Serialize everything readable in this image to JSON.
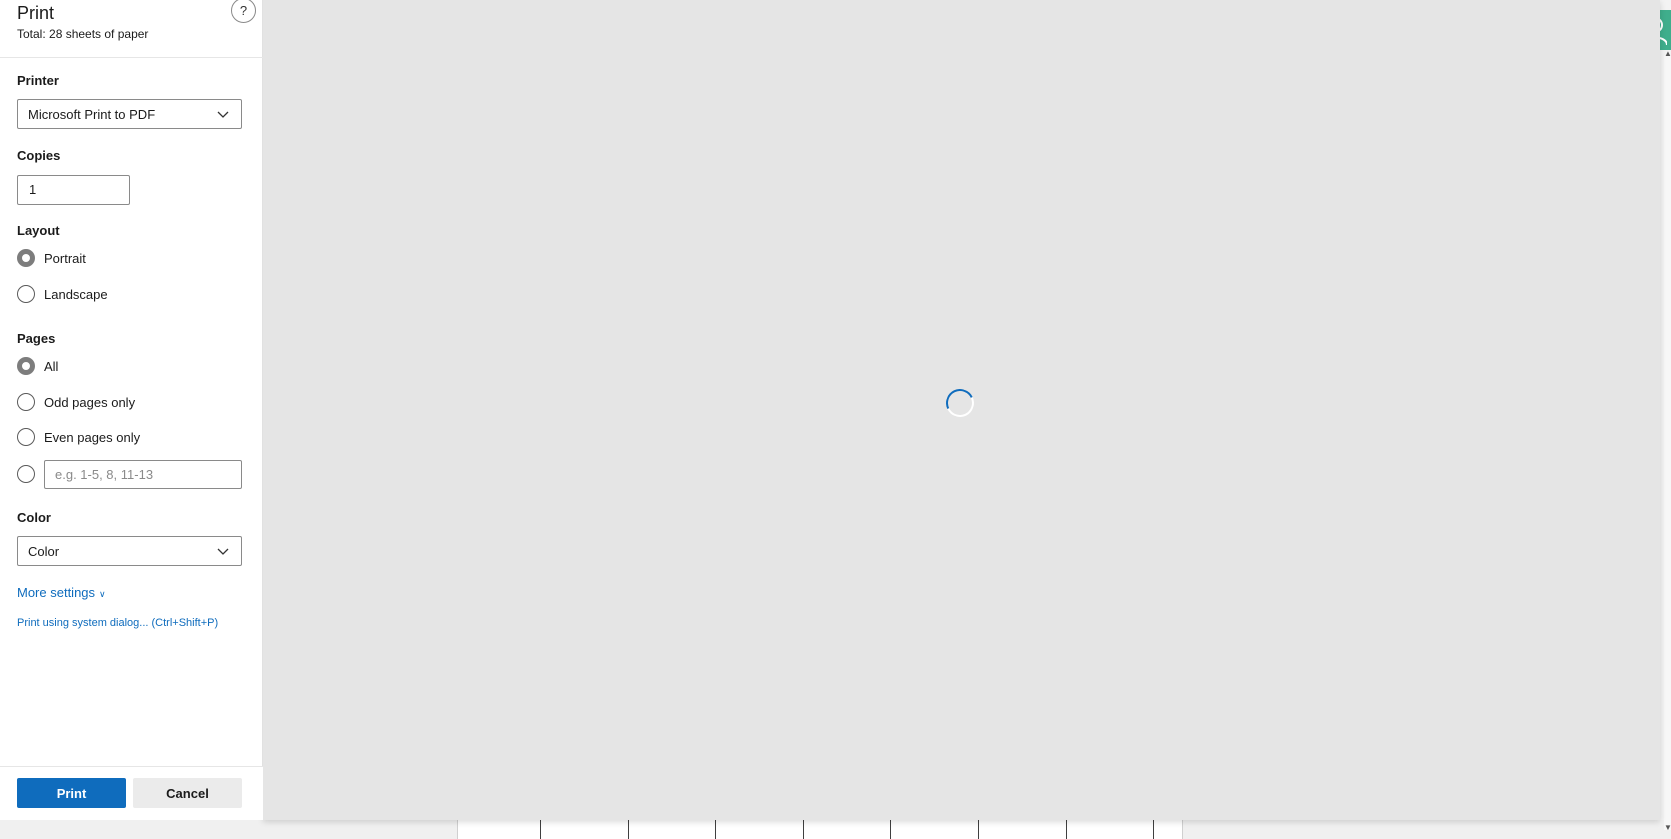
{
  "header": {
    "title": "Print",
    "subtitle": "Total: 28 sheets of paper",
    "help_label": "?"
  },
  "printer": {
    "label": "Printer",
    "selected": "Microsoft Print to PDF"
  },
  "copies": {
    "label": "Copies",
    "value": "1"
  },
  "layout": {
    "label": "Layout",
    "options": [
      {
        "label": "Portrait",
        "checked": true
      },
      {
        "label": "Landscape",
        "checked": false
      }
    ]
  },
  "pages": {
    "label": "Pages",
    "options": [
      {
        "label": "All",
        "checked": true
      },
      {
        "label": "Odd pages only",
        "checked": false
      },
      {
        "label": "Even pages only",
        "checked": false
      }
    ],
    "custom_placeholder": "e.g. 1-5, 8, 11-13"
  },
  "color": {
    "label": "Color",
    "selected": "Color"
  },
  "links": {
    "more_settings": "More settings",
    "system_dialog": "Print using system dialog... (Ctrl+Shift+P)"
  },
  "footer": {
    "print_label": "Print",
    "cancel_label": "Cancel"
  },
  "colors": {
    "accent": "#0f6cbd",
    "preview_bg": "#e5e5e5",
    "avatar_bg": "#3fae8c"
  },
  "icons": {
    "help": "help-icon",
    "dropdown": "chevron-down-icon",
    "avatar": "user-icon",
    "loading": "loading-spinner-icon"
  }
}
